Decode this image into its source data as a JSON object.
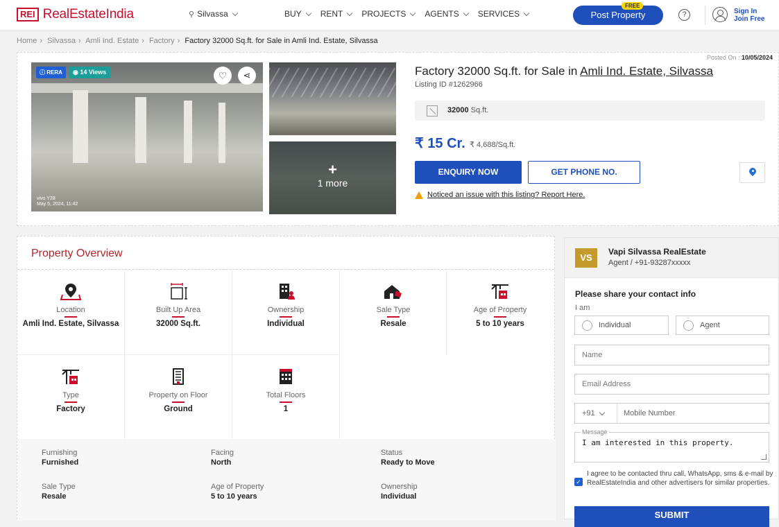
{
  "header": {
    "logo_box": "REI",
    "logo_text": "RealEstateIndia",
    "city": "Silvassa",
    "nav": [
      "BUY",
      "RENT",
      "PROJECTS",
      "AGENTS",
      "SERVICES"
    ],
    "post_label": "Post Property",
    "free_label": "FREE",
    "help": "?",
    "sign_in": "Sign In",
    "join_free": "Join Free"
  },
  "breadcrumb": {
    "items": [
      "Home",
      "Silvassa",
      "Amli Ind. Estate",
      "Factory"
    ],
    "current": "Factory 32000 Sq.ft. for Sale in Amli Ind. Estate, Silvassa"
  },
  "listing": {
    "posted_label": "Posted On :",
    "posted_date": "10/05/2024",
    "title_prefix": "Factory 32000 Sq.ft. for Sale in ",
    "title_location": "Amli Ind. Estate, Silvassa",
    "listing_id": "Listing ID #1262966",
    "area_value": "32000",
    "area_unit": "Sq.ft.",
    "price": "₹ 15 Cr.",
    "price_per": "₹ 4,688/Sq.ft.",
    "enquiry_label": "ENQUIRY NOW",
    "phone_label": "GET PHONE NO.",
    "report_text": "Noticed an issue with this listing? Report Here.",
    "badge_rera": "RERA",
    "badge_views": "14 Views",
    "more_label": "1 more",
    "watermark_line1": "vivo Y28",
    "watermark_line2": "May 5, 2024, 11:42"
  },
  "overview": {
    "title": "Property Overview",
    "cells": [
      {
        "label": "Location",
        "value": "Amli Ind. Estate, Silvassa",
        "icon": "location-pin-icon"
      },
      {
        "label": "Built Up Area",
        "value": "32000 Sq.ft.",
        "icon": "area-icon"
      },
      {
        "label": "Ownership",
        "value": "Individual",
        "icon": "ownership-icon"
      },
      {
        "label": "Sale Type",
        "value": "Resale",
        "icon": "sale-type-icon"
      },
      {
        "label": "Age of Property",
        "value": "5 to 10 years",
        "icon": "crane-icon"
      },
      {
        "label": "Type",
        "value": "Factory",
        "icon": "crane-icon"
      },
      {
        "label": "Property on Floor",
        "value": "Ground",
        "icon": "building-icon"
      },
      {
        "label": "Total Floors",
        "value": "1",
        "icon": "floors-icon"
      }
    ],
    "details": [
      {
        "label": "Furnishing",
        "value": "Furnished"
      },
      {
        "label": "Facing",
        "value": "North"
      },
      {
        "label": "Status",
        "value": "Ready to Move"
      },
      {
        "label": "Sale Type",
        "value": "Resale"
      },
      {
        "label": "Age of Property",
        "value": "5 to 10 years"
      },
      {
        "label": "Ownership",
        "value": "Individual"
      }
    ]
  },
  "contact": {
    "avatar": "VS",
    "agent_name": "Vapi Silvassa RealEstate",
    "agent_role": "Agent / +91-93287xxxxx",
    "share_label": "Please share your contact info",
    "iam_label": "I am",
    "radio_individual": "Individual",
    "radio_agent": "Agent",
    "name_placeholder": "Name",
    "email_placeholder": "Email Address",
    "country_code": "+91",
    "mobile_placeholder": "Mobile Number",
    "message_label": "Message",
    "message_value": "I am interested in this property.",
    "agree_text": "I agree to be contacted thru call, WhatsApp, sms & e-mail by RealEstateIndia and other advertisers for similar properties.",
    "submit_label": "SUBMIT"
  },
  "colors": {
    "brand_red": "#c8102e",
    "primary_blue": "#1e4fbb",
    "views_teal": "#1c9f9a"
  }
}
